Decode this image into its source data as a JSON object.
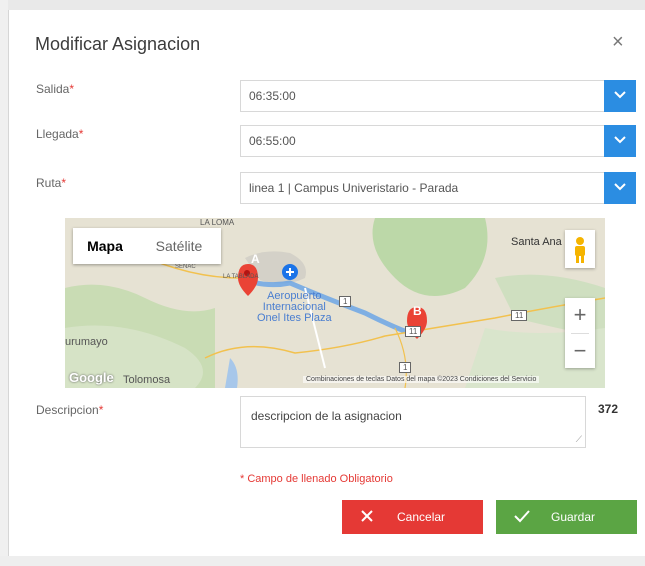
{
  "modal": {
    "title": "Modificar Asignacion",
    "close_glyph": "×"
  },
  "fields": {
    "salida": {
      "label": "Salida",
      "value": "06:35:00"
    },
    "llegada": {
      "label": "Llegada",
      "value": "06:55:00"
    },
    "ruta": {
      "label": "Ruta",
      "value": "linea 1 | Campus Univeristario - Parada"
    },
    "descripcion": {
      "label": "Descripcion",
      "value": "descripcion de la asignacion",
      "count": "372"
    },
    "required_mark": "*"
  },
  "map": {
    "type_map": "Mapa",
    "type_satellite": "Satélite",
    "labels": {
      "la_loma": "LA LOMA",
      "santa_ana": "Santa Ana",
      "aeropuerto": "Aeropuerto\nInternacional\nOnel Ites Plaza",
      "urumayo": "urumayo",
      "tolomosa": "Tolomosa",
      "senac": "SENAC",
      "tablada": "LA TABLADA"
    },
    "marker_a": "A",
    "marker_b": "B",
    "route_shields": [
      "1",
      "11",
      "11",
      "1"
    ],
    "google": "Google",
    "attribution": "Combinaciones de teclas   Datos del mapa ©2023   Condiciones del Servicio",
    "zoom_in": "+",
    "zoom_out": "−",
    "route_color": "#5c9ee8",
    "marker_color": "#ea4335"
  },
  "required_note": "* Campo de llenado Obligatorio",
  "buttons": {
    "cancel": "Cancelar",
    "save": "Guardar"
  },
  "colors": {
    "primary": "#2b8de2",
    "danger": "#e53935",
    "success": "#5ba544"
  },
  "icons": {
    "dropdown": "chevron-down-icon",
    "cancel": "close-icon",
    "save": "check-icon",
    "pegman": "pegman-icon"
  }
}
